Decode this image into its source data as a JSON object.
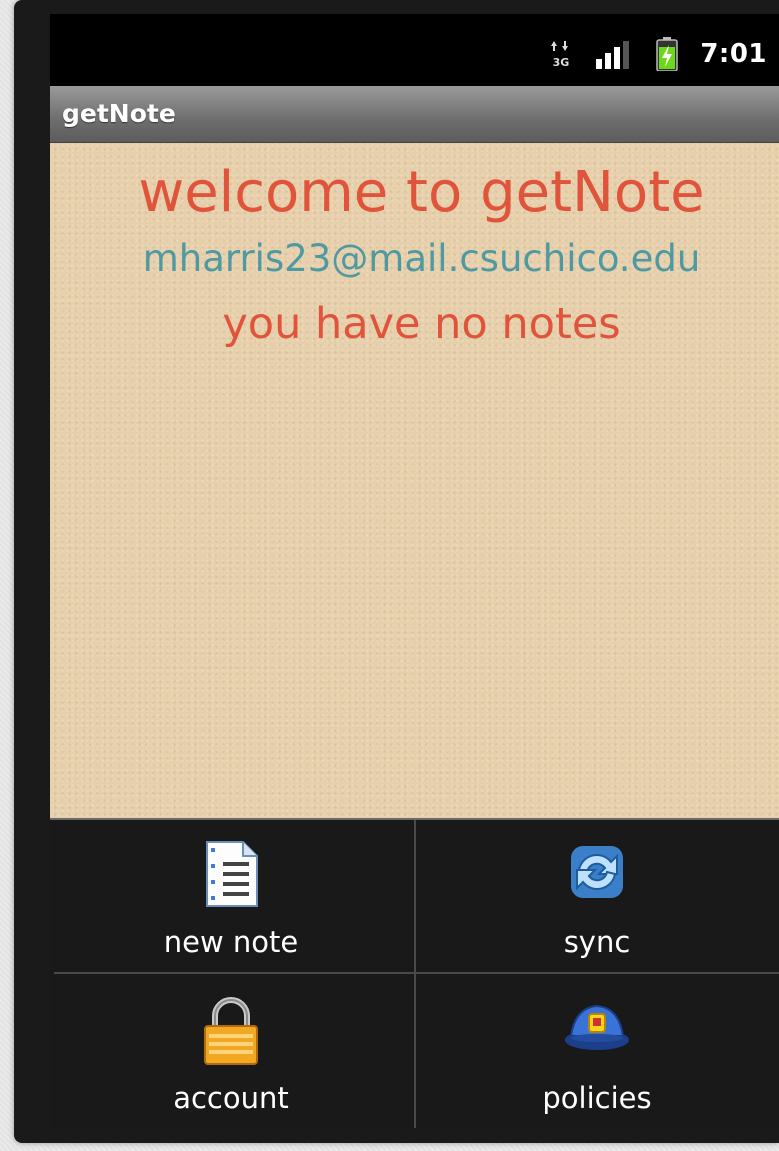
{
  "status_bar": {
    "time": "7:01",
    "icons": [
      "3g-data-icon",
      "signal-icon",
      "battery-charging-icon"
    ]
  },
  "title_bar": {
    "title": "getNote"
  },
  "main": {
    "welcome": "welcome to getNote",
    "email": "mharris23@mail.csuchico.edu",
    "notes_status": "you have no notes"
  },
  "menu": {
    "items": [
      {
        "label": "new note",
        "icon": "note-document-icon"
      },
      {
        "label": "sync",
        "icon": "sync-icon"
      },
      {
        "label": "account",
        "icon": "padlock-icon"
      },
      {
        "label": "policies",
        "icon": "police-cap-icon"
      }
    ]
  },
  "colors": {
    "accent_text": "#e0543c",
    "email_text": "#4f9aa2",
    "paper_background": "#e6cfaa",
    "menu_background": "#191919"
  }
}
